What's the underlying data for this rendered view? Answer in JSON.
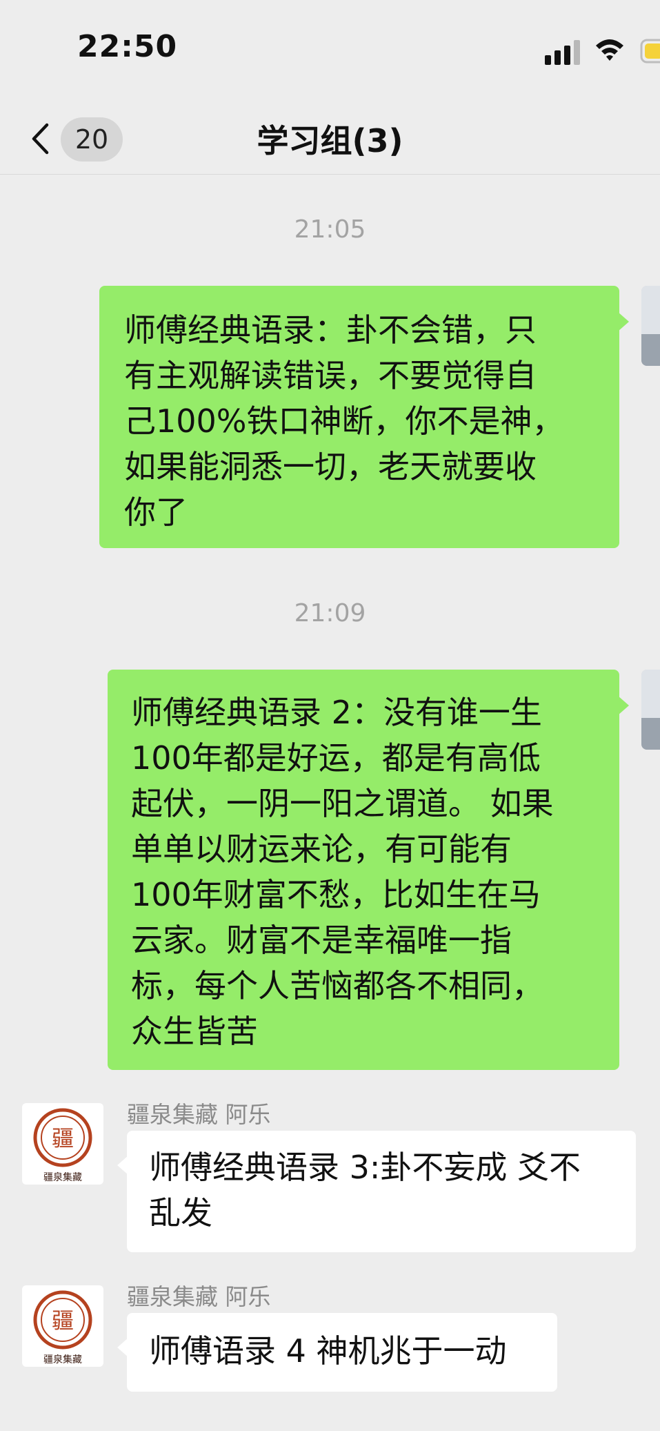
{
  "status_bar": {
    "time": "22:50",
    "icons": [
      "signal-icon",
      "wifi-icon",
      "battery-icon"
    ]
  },
  "nav": {
    "back_icon": "chevron-left-icon",
    "unread_count": "20",
    "title": "学习组(3)"
  },
  "messages": [
    {
      "type": "timestamp",
      "text": "21:05"
    },
    {
      "type": "outgoing",
      "lines": [
        "师傅经典语录：卦不会错，只",
        "有主观解读错误，不要觉得自",
        "己100%铁口神断，你不是神，",
        "如果能洞悉一切，老天就要收",
        "你了"
      ]
    },
    {
      "type": "timestamp",
      "text": "21:09"
    },
    {
      "type": "outgoing",
      "lines": [
        "师傅经典语录 2：没有谁一生",
        "100年都是好运，都是有高低",
        "起伏，一阴一阳之谓道。 如果",
        "单单以财运来论，有可能有",
        "100年财富不愁，比如生在马",
        "云家。财富不是幸福唯一指",
        "标，每个人苦恼都各不相同，",
        "众生皆苦"
      ]
    },
    {
      "type": "incoming",
      "sender": "疆泉集藏  阿乐",
      "avatar_text": [
        "疆",
        "疆泉集藏"
      ],
      "lines": [
        "师傅经典语录 3:卦不妄成 爻不",
        "乱发"
      ]
    },
    {
      "type": "incoming",
      "sender": "疆泉集藏  阿乐",
      "avatar_text": [
        "疆",
        "疆泉集藏"
      ],
      "lines": [
        "师傅语录 4 神机兆于一动"
      ]
    }
  ],
  "colors": {
    "background": "#ededed",
    "outgoing_bubble": "#95ec69",
    "incoming_bubble": "#ffffff",
    "timestamp": "#a3a3a3",
    "sender_name": "#8a8a8a",
    "seal_red": "#b5421f"
  }
}
